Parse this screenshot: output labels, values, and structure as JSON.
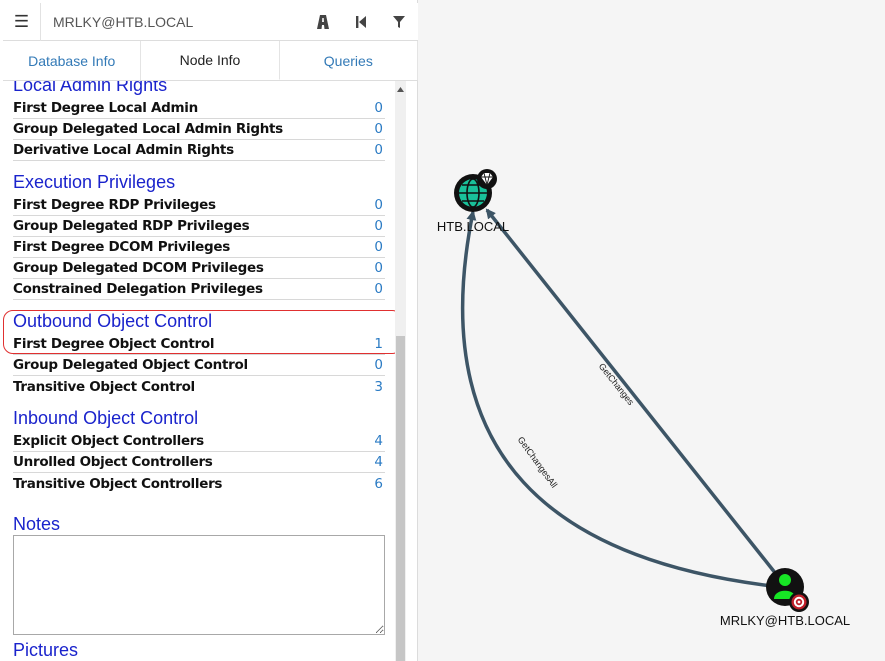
{
  "search": {
    "value": "MRLKY@HTB.LOCAL"
  },
  "toolbar": {
    "menu_icon": "menu-icon",
    "path_icon": "road-icon",
    "back_icon": "step-backward-icon",
    "filter_icon": "filter-icon"
  },
  "tabs": [
    {
      "label": "Database Info",
      "active": false
    },
    {
      "label": "Node Info",
      "active": true
    },
    {
      "label": "Queries",
      "active": false
    }
  ],
  "sections": {
    "local_admin": {
      "title": "Local Admin Rights",
      "rows": [
        {
          "label": "First Degree Local Admin",
          "value": "0"
        },
        {
          "label": "Group Delegated Local Admin Rights",
          "value": "0"
        },
        {
          "label": "Derivative Local Admin Rights",
          "value": "0"
        }
      ]
    },
    "execution": {
      "title": "Execution Privileges",
      "rows": [
        {
          "label": "First Degree RDP Privileges",
          "value": "0"
        },
        {
          "label": "Group Delegated RDP Privileges",
          "value": "0"
        },
        {
          "label": "First Degree DCOM Privileges",
          "value": "0"
        },
        {
          "label": "Group Delegated DCOM Privileges",
          "value": "0"
        },
        {
          "label": "Constrained Delegation Privileges",
          "value": "0"
        }
      ]
    },
    "outbound": {
      "title": "Outbound Object Control",
      "rows": [
        {
          "label": "First Degree Object Control",
          "value": "1"
        },
        {
          "label": "Group Delegated Object Control",
          "value": "0"
        },
        {
          "label": "Transitive Object Control",
          "value": "3"
        }
      ]
    },
    "inbound": {
      "title": "Inbound Object Control",
      "rows": [
        {
          "label": "Explicit Object Controllers",
          "value": "4"
        },
        {
          "label": "Unrolled Object Controllers",
          "value": "4"
        },
        {
          "label": "Transitive Object Controllers",
          "value": "6"
        }
      ]
    },
    "notes": {
      "title": "Notes",
      "value": ""
    },
    "pictures": {
      "title": "Pictures"
    }
  },
  "graph": {
    "nodes": {
      "domain": {
        "label": "HTB.LOCAL",
        "icon": "globe-icon",
        "badge": "gem-icon"
      },
      "user": {
        "label": "MRLKY@HTB.LOCAL",
        "icon": "user-icon",
        "badge": "target-icon"
      }
    },
    "edges": [
      {
        "label": "GetChanges"
      },
      {
        "label": "GetChangesAll"
      }
    ]
  },
  "colors": {
    "link": "#2b7bc4",
    "section_title": "#1a23cc",
    "highlight": "#e03030",
    "edge": "#3d5566",
    "domain_fill": "#19c19a",
    "user_fill": "#17e625",
    "target": "#c0202a"
  }
}
